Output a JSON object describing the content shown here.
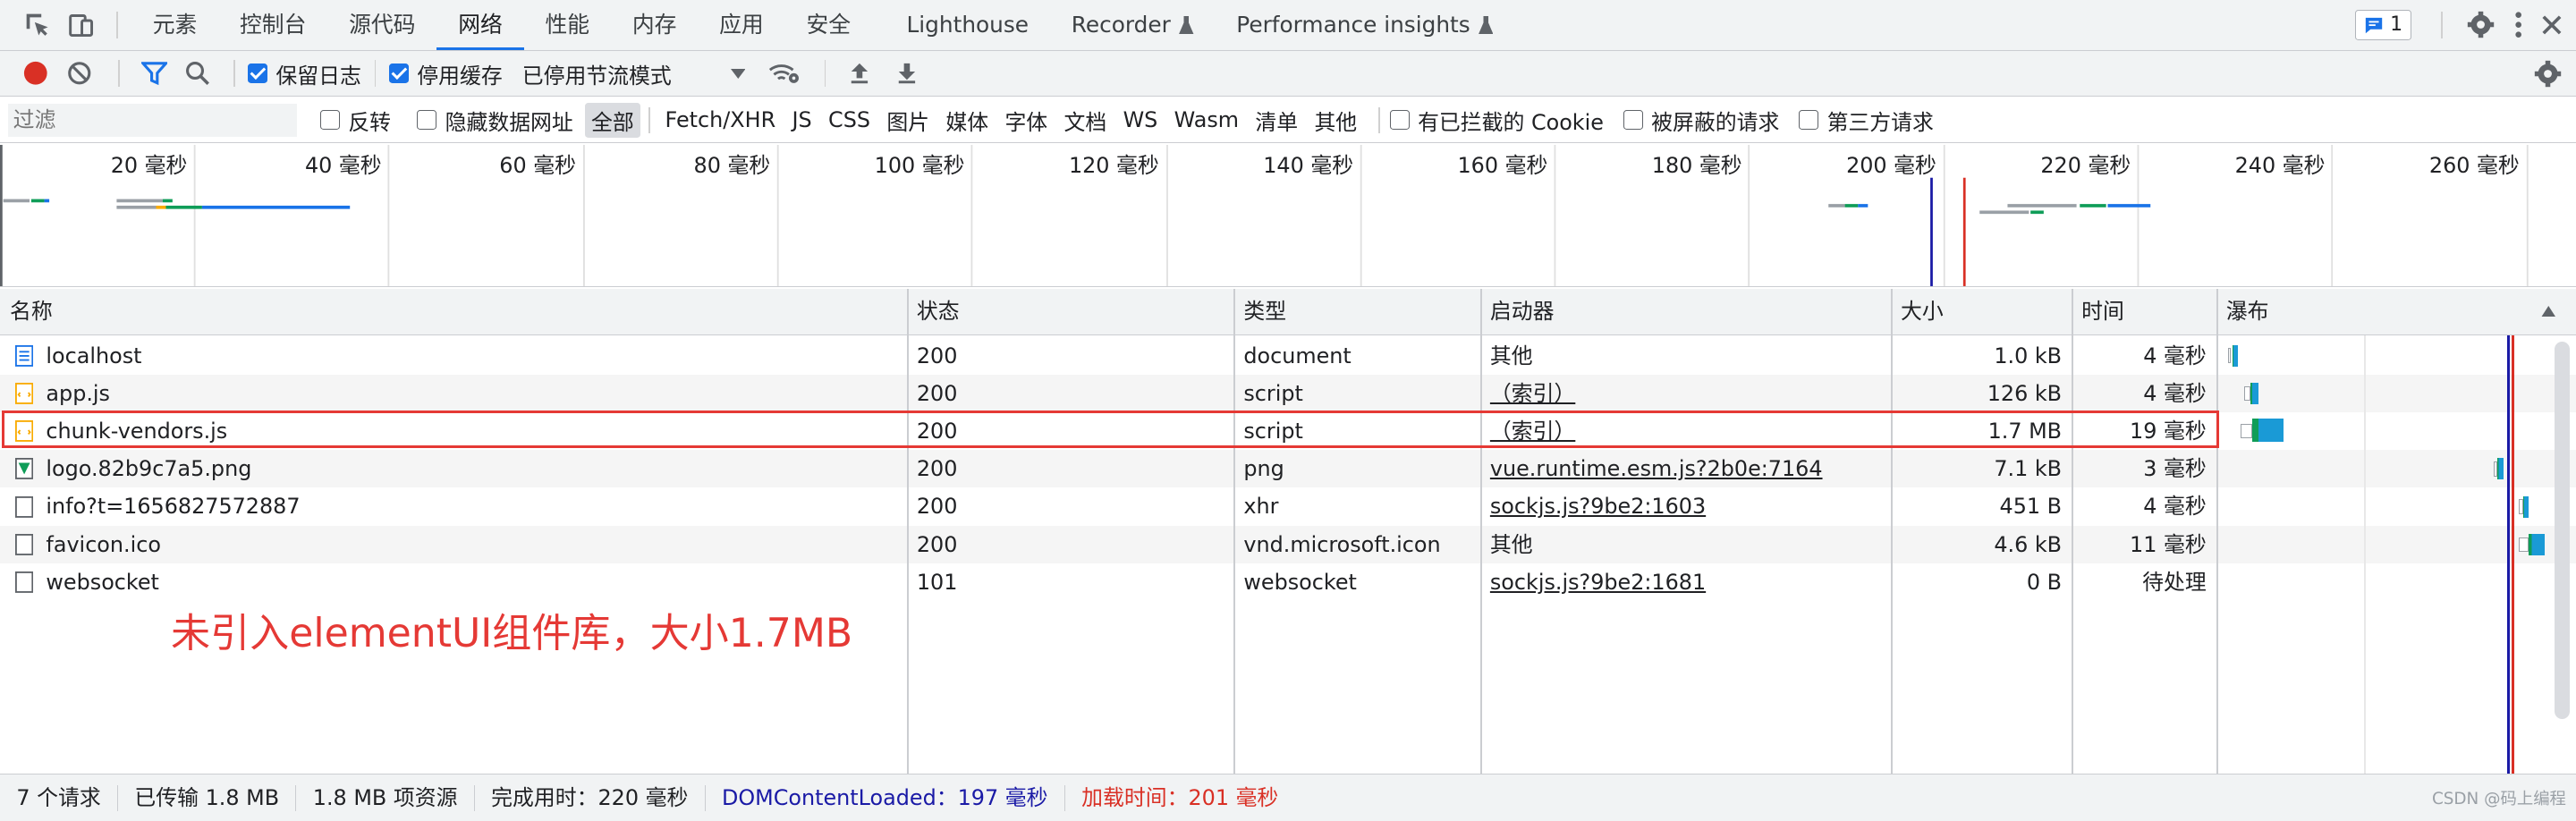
{
  "tabs": [
    "元素",
    "控制台",
    "源代码",
    "网络",
    "性能",
    "内存",
    "应用",
    "安全",
    "Lighthouse",
    "Recorder",
    "Performance insights"
  ],
  "active_tab": "网络",
  "issues_count": "1",
  "toolbar": {
    "preserve_log": "保留日志",
    "disable_cache": "停用缓存",
    "throttling": "已停用节流模式"
  },
  "filter": {
    "placeholder": "过滤",
    "invert": "反转",
    "hide_data_urls": "隐藏数据网址",
    "types": [
      "全部",
      "Fetch/XHR",
      "JS",
      "CSS",
      "图片",
      "媒体",
      "字体",
      "文档",
      "WS",
      "Wasm",
      "清单",
      "其他"
    ],
    "blocked_cookies": "有已拦截的 Cookie",
    "blocked_requests": "被屏蔽的请求",
    "third_party": "第三方请求"
  },
  "overview_ticks": [
    "20 毫秒",
    "40 毫秒",
    "60 毫秒",
    "80 毫秒",
    "100 毫秒",
    "120 毫秒",
    "140 毫秒",
    "160 毫秒",
    "180 毫秒",
    "200 毫秒",
    "220 毫秒",
    "240 毫秒",
    "260 毫秒"
  ],
  "columns": {
    "name": "名称",
    "status": "状态",
    "type": "类型",
    "initiator": "启动器",
    "size": "大小",
    "time": "时间",
    "waterfall": "瀑布"
  },
  "rows": [
    {
      "name": "localhost",
      "status": "200",
      "type": "document",
      "initiator": "其他",
      "initiator_link": false,
      "size": "1.0 kB",
      "time": "4 毫秒",
      "icon": "document-icon"
    },
    {
      "name": "app.js",
      "status": "200",
      "type": "script",
      "initiator": "（索引）",
      "initiator_link": true,
      "size": "126 kB",
      "time": "4 毫秒",
      "icon": "script-icon"
    },
    {
      "name": "chunk-vendors.js",
      "status": "200",
      "type": "script",
      "initiator": "（索引）",
      "initiator_link": true,
      "size": "1.7 MB",
      "time": "19 毫秒",
      "icon": "script-icon"
    },
    {
      "name": "logo.82b9c7a5.png",
      "status": "200",
      "type": "png",
      "initiator": "vue.runtime.esm.js?2b0e:7164",
      "initiator_link": true,
      "size": "7.1 kB",
      "time": "3 毫秒",
      "icon": "image-icon"
    },
    {
      "name": "info?t=1656827572887",
      "status": "200",
      "type": "xhr",
      "initiator": "sockjs.js?9be2:1603",
      "initiator_link": true,
      "size": "451 B",
      "time": "4 毫秒",
      "icon": "file-icon"
    },
    {
      "name": "favicon.ico",
      "status": "200",
      "type": "vnd.microsoft.icon",
      "initiator": "其他",
      "initiator_link": false,
      "size": "4.6 kB",
      "time": "11 毫秒",
      "icon": "file-icon"
    },
    {
      "name": "websocket",
      "status": "101",
      "type": "websocket",
      "initiator": "sockjs.js?9be2:1681",
      "initiator_link": true,
      "size": "0 B",
      "time": "待处理",
      "icon": "file-icon"
    }
  ],
  "annotation": "未引入elementUI组件库，大小1.7MB",
  "status": {
    "requests": "7 个请求",
    "transferred": "已传输 1.8 MB",
    "resources": "1.8 MB 项资源",
    "finish": "完成用时：220 毫秒",
    "dcl": "DOMContentLoaded：197 毫秒",
    "load": "加载时间：201 毫秒"
  },
  "watermark": "CSDN @码上编程",
  "colors": {
    "accent": "#1a73e8",
    "dcl": "#1a1aa6",
    "load": "#d93025",
    "highlight": "#e53935",
    "annotation": "#e53935"
  }
}
